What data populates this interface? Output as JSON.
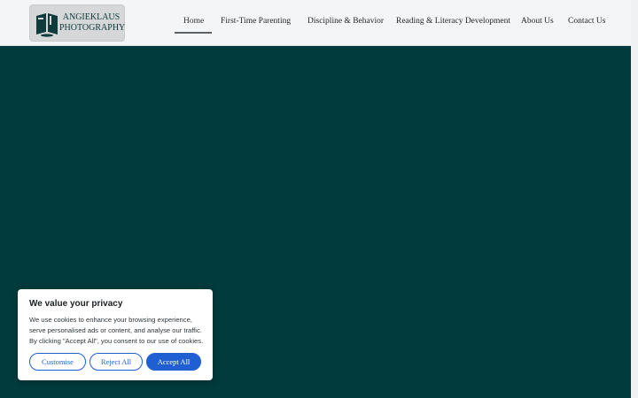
{
  "header": {
    "logo": {
      "line1": "ANGIEKLAUS",
      "line2": "PHOTOGRAPHY"
    },
    "nav": [
      {
        "label": "Home",
        "active": true
      },
      {
        "label": "First-Time Parenting"
      },
      {
        "label": "Discipline & Behavior"
      },
      {
        "label": "Reading & Literacy Development"
      },
      {
        "label": "About Us"
      },
      {
        "label": "Contact Us"
      }
    ]
  },
  "colors": {
    "hero_background": "#023b3d",
    "header_background": "#f4f5f6",
    "accent": "#1f5fd1"
  },
  "cookie_banner": {
    "title": "We value your privacy",
    "text_lines": [
      "We use cookies to enhance your browsing experience,",
      "serve personalised ads or content, and analyse our traffic.",
      "By clicking \"Accept All\", you consent to our use of cookies."
    ],
    "buttons": {
      "customise": "Customise",
      "reject": "Reject All",
      "accept": "Accept All"
    }
  }
}
